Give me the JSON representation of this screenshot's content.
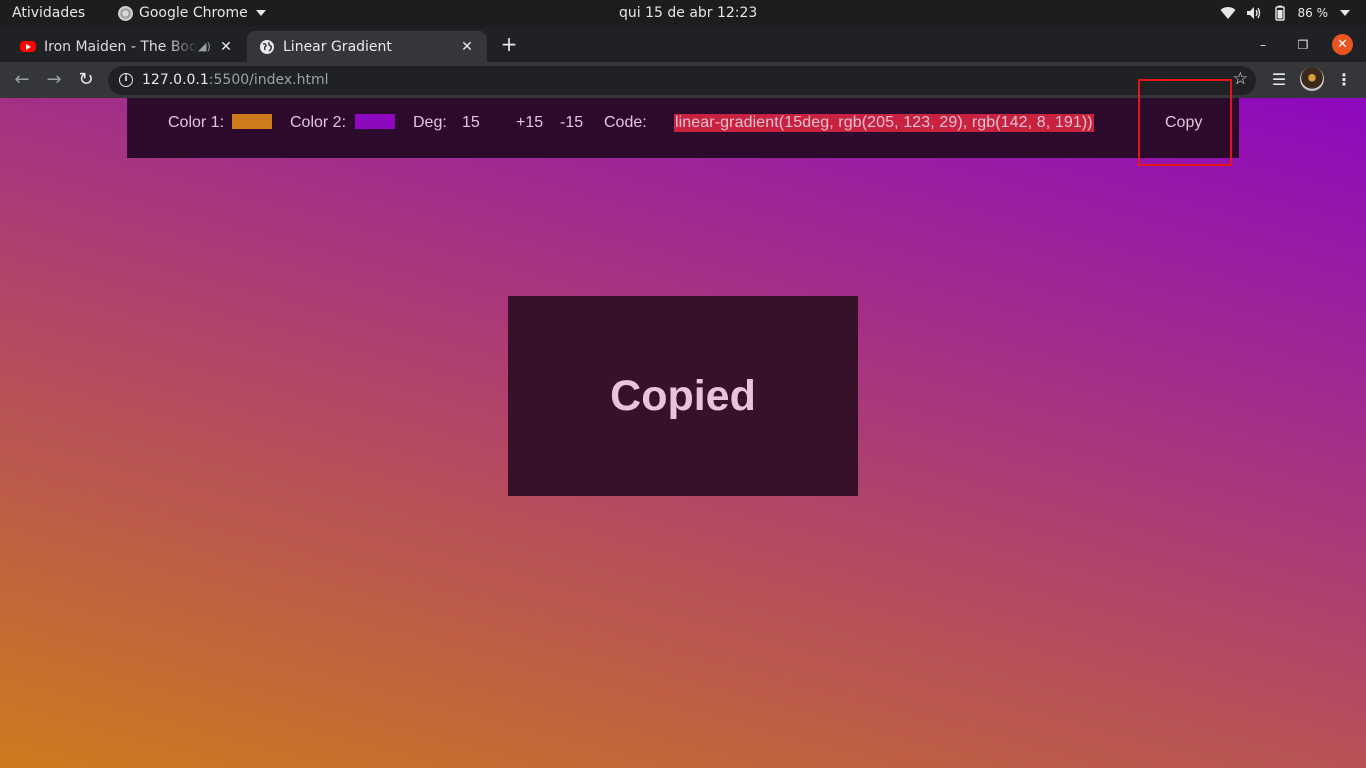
{
  "os_bar": {
    "activities": "Atividades",
    "app_name": "Google Chrome",
    "clock": "qui 15 de abr  12:23",
    "battery": "86 %"
  },
  "tabs": [
    {
      "title": "Iron Maiden - The Book of Souls",
      "favicon": "youtube-icon",
      "audio": true
    },
    {
      "title": "Linear Gradient",
      "favicon": "globe-icon",
      "active": true
    }
  ],
  "toolbar": {
    "url_host": "127.0.0.1",
    "url_rest": ":5500/index.html"
  },
  "page": {
    "background_gradient": {
      "angle_deg": 15,
      "color1": "#cd7b1d",
      "color2": "#8e08bf"
    },
    "controls": {
      "color1_label": "Color 1:",
      "color1_value": "#cd7b1d",
      "color2_label": "Color 2:",
      "color2_value": "#8e08bf",
      "deg_label": "Deg:",
      "deg_value": "15",
      "plus_label": "+15",
      "minus_label": "-15",
      "code_label": "Code:",
      "code_value": "linear-gradient(15deg, rgb(205, 123, 29), rgb(142, 8, 191))",
      "copy_label": "Copy"
    },
    "toast": "Copied"
  },
  "colors": {
    "highlight_border": "#e8141c",
    "code_highlight": "#c8223f"
  }
}
